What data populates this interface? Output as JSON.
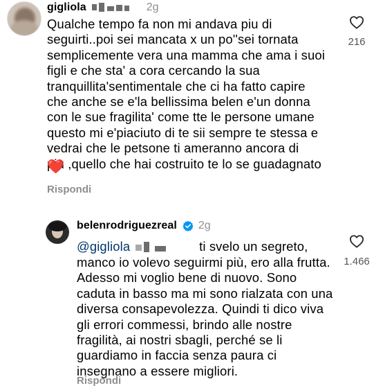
{
  "comments": [
    {
      "username": "gigliola",
      "time": "2g",
      "text": "Qualche tempo fa non mi andava piu di\nseguirti..poi sei mancata x un po''sei tornata\nsemplicemente vera una mamma che ama  i suoi\nfigli  e che sta' a cora cercando la sua\ntranquillita'sentimentale  che ci ha fatto capire\nche anche se e'la bellissima belen e'un donna\ncon le sue fragilita' come tte le persone umane\nquesto mi e'piaciuto di te sii sempre te stessa  e\nvedrai  che le petsone ti ameranno ancora di\npiu ,quello che hai costruito te lo se guadagnato",
      "emoji": "❤️",
      "reply_label": "Rispondi",
      "likes": "216"
    },
    {
      "username": "belenrodriguezreal",
      "time": "2g",
      "verified": true,
      "mention": "@gigliola",
      "text_first": "ti svelo un segreto,",
      "text": "manco io volevo seguirmi più, ero alla frutta.\nAdesso mi voglio bene di nuovo. Sono\ncaduta in basso ma mi sono rialzata con una\ndiversa consapevolezza. Quindi ti dico viva\ngli errori commessi, brindo alle nostre\nfragilità, ai nostri sbagli, perché se li\nguardiamo in faccia senza paura ci\ninsegnano a essere migliori.",
      "reply_label": "Rispondi",
      "likes": "1.466"
    }
  ],
  "colors": {
    "text": "#000000",
    "meta": "#8e8e8e",
    "mention": "#00376b",
    "verified": "#0095f6",
    "heart_emoji": "#e0245e"
  },
  "icons": [
    "heart-outline-icon",
    "verified-badge-icon",
    "avatar"
  ]
}
